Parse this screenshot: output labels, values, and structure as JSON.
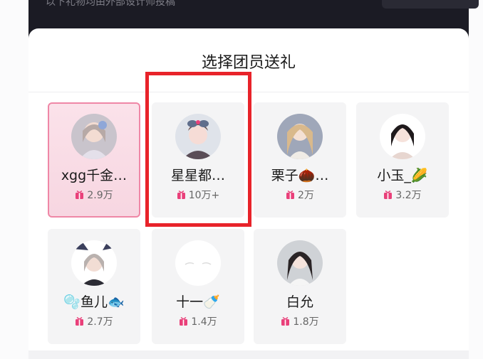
{
  "header": {
    "text": "以下礼物均由外部设计师投稿"
  },
  "panel": {
    "title": "选择团员送礼"
  },
  "members": [
    {
      "name": "xgg千金…",
      "gift_count": "2.9万",
      "selected": true,
      "avatar_icon": "avatar-photo-icon"
    },
    {
      "name": "星星都…",
      "gift_count": "10万+",
      "selected": false,
      "avatar_icon": "avatar-photo-icon"
    },
    {
      "name": "栗子🌰…",
      "gift_count": "2万",
      "selected": false,
      "avatar_icon": "avatar-photo-icon"
    },
    {
      "name": "小玉_🌽",
      "gift_count": "3.2万",
      "selected": false,
      "avatar_icon": "avatar-photo-icon"
    },
    {
      "name": "🫧鱼儿🐟",
      "gift_count": "2.7万",
      "selected": false,
      "avatar_icon": "avatar-photo-icon"
    },
    {
      "name": "十一🍼",
      "gift_count": "1.4万",
      "selected": false,
      "avatar_icon": "avatar-placeholder-icon"
    },
    {
      "name": "白允",
      "gift_count": "1.8万",
      "selected": false,
      "avatar_icon": "avatar-photo-icon"
    }
  ],
  "colors": {
    "accent_pink": "#e9407a",
    "highlight_red": "#e8232a",
    "selected_card_border": "#ef87a6",
    "dark_header": "#1b1b24"
  }
}
